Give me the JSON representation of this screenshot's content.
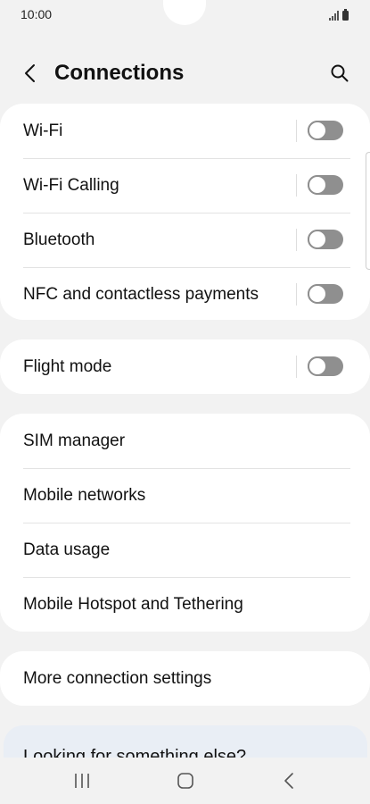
{
  "status_bar": {
    "time": "10:00",
    "icons": [
      "signal-icon",
      "battery-icon"
    ]
  },
  "header": {
    "title": "Connections",
    "back_icon": "chevron-left-icon",
    "search_icon": "search-icon"
  },
  "groups": {
    "radios": [
      {
        "label": "Wi-Fi",
        "toggle": "off"
      },
      {
        "label": "Wi-Fi Calling",
        "toggle": "off"
      },
      {
        "label": "Bluetooth",
        "toggle": "off"
      },
      {
        "label": "NFC and contactless payments",
        "toggle": "off"
      }
    ],
    "flight": [
      {
        "label": "Flight mode",
        "toggle": "off"
      }
    ],
    "network": [
      {
        "label": "SIM manager"
      },
      {
        "label": "Mobile networks"
      },
      {
        "label": "Data usage"
      },
      {
        "label": "Mobile Hotspot and Tethering"
      }
    ],
    "more": [
      {
        "label": "More connection settings"
      }
    ]
  },
  "suggestion": {
    "text": "Looking for something else?"
  },
  "nav_bar": {
    "icons": [
      "recents-icon",
      "home-icon",
      "back-icon"
    ]
  },
  "colors": {
    "background": "#f2f2f2",
    "card": "#ffffff",
    "toggle_off": "#8f8f8f",
    "suggestion_card": "#e9eef5"
  }
}
